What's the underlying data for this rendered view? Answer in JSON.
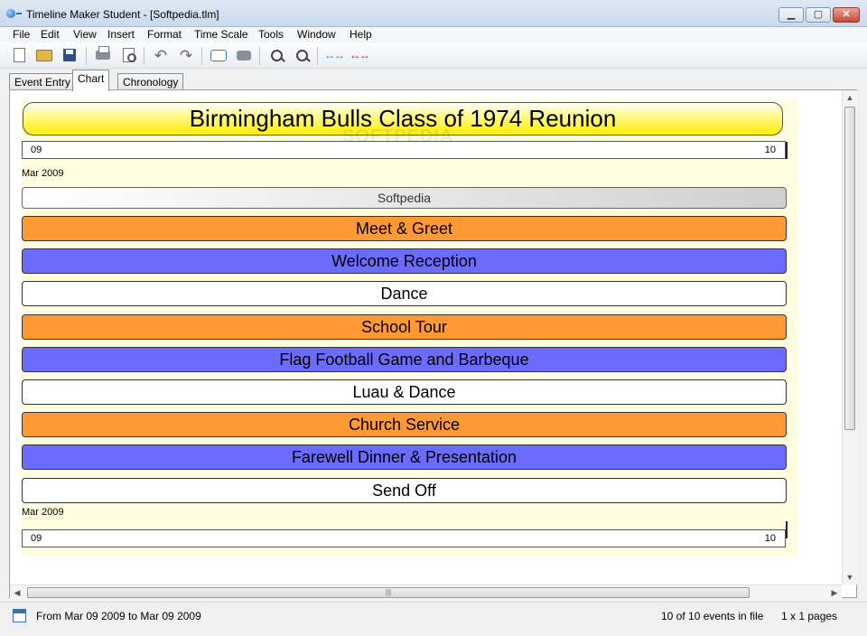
{
  "window": {
    "title": "Timeline Maker Student - [Softpedia.tlm]",
    "controls": {
      "minimize": "▁",
      "maximize": "▢",
      "close": "✕"
    }
  },
  "menu": [
    "File",
    "Edit",
    "View",
    "Insert",
    "Format",
    "Time Scale",
    "Tools",
    "Window",
    "Help"
  ],
  "toolbar": {
    "icons": [
      "new-document-icon",
      "open-folder-icon",
      "save-icon",
      "print-icon",
      "print-preview-icon",
      "undo-icon",
      "redo-icon",
      "add-note-icon",
      "comment-icon",
      "zoom-in-icon",
      "zoom-out-icon",
      "expand-span-icon",
      "collapse-span-icon"
    ]
  },
  "tabs": [
    "Event Entry",
    "Chart",
    "Chronology"
  ],
  "active_tab": "Chart",
  "chart": {
    "title": "Birmingham Bulls Class of 1974 Reunion",
    "watermark": "SOFTPEDIA",
    "top_scale": {
      "left": "09",
      "right": "10"
    },
    "top_month": "Mar 2009",
    "header_bar": "Softpedia",
    "events": [
      {
        "label": "Meet & Greet",
        "color": "#ff9933"
      },
      {
        "label": "Welcome Reception",
        "color": "#6b6bff"
      },
      {
        "label": "Dance",
        "color": "#ffffff"
      },
      {
        "label": "School Tour",
        "color": "#ff9933"
      },
      {
        "label": "Flag Football Game and Barbeque",
        "color": "#6b6bff"
      },
      {
        "label": "Luau & Dance",
        "color": "#ffffff"
      },
      {
        "label": "Church Service",
        "color": "#ff9933"
      },
      {
        "label": "Farewell Dinner & Presentation",
        "color": "#6b6bff"
      },
      {
        "label": "Send Off",
        "color": "#ffffff"
      }
    ],
    "bottom_month": "Mar 2009",
    "bottom_scale": {
      "left": "09",
      "right": "10"
    }
  },
  "scrollbars": {
    "up": "▲",
    "down": "▼",
    "left": "◀",
    "right": "▶",
    "grip": "|||"
  },
  "status": {
    "range": "From Mar 09 2009 to Mar 09 2009",
    "events_count": "10 of 10 events in file",
    "pages": "1 x 1 pages"
  }
}
